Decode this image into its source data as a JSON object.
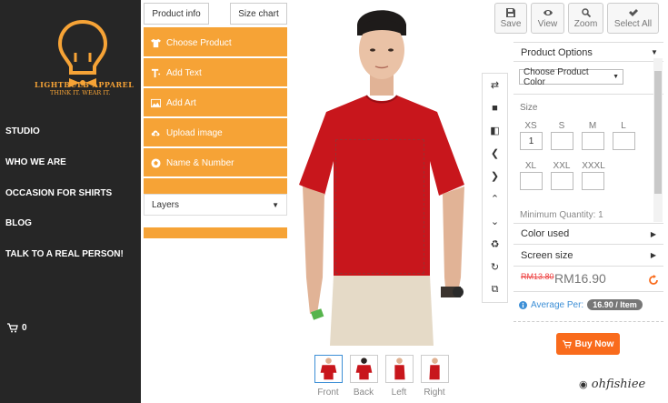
{
  "brand": {
    "name": "LIGHTBULB APPAREL",
    "tagline": "THINK IT. WEAR IT.",
    "color": "#f6a336"
  },
  "nav": {
    "items": [
      "STUDIO",
      "WHO WE ARE",
      "OCCASION FOR SHIRTS",
      "BLOG",
      "TALK TO A REAL PERSON!"
    ],
    "cart_count": "0"
  },
  "tabs": {
    "product_info": "Product info",
    "size_chart": "Size chart"
  },
  "menu": {
    "items": [
      {
        "label": "Choose Product",
        "icon": "tshirt-icon"
      },
      {
        "label": "Add Text",
        "icon": "text-icon"
      },
      {
        "label": "Add Art",
        "icon": "image-icon"
      },
      {
        "label": "Upload image",
        "icon": "cloud-upload-icon"
      },
      {
        "label": "Name & Number",
        "icon": "ball-icon"
      }
    ],
    "layers_label": "Layers"
  },
  "actions": {
    "save": "Save",
    "view": "View",
    "zoom": "Zoom",
    "select_all": "Select All"
  },
  "views": [
    "Front",
    "Back",
    "Left",
    "Right"
  ],
  "options": {
    "title": "Product Options",
    "color_select": "Choose Product Color",
    "size_label": "Size",
    "sizes_row1": [
      "XS",
      "S",
      "M",
      "L"
    ],
    "sizes_row2": [
      "XL",
      "XXL",
      "XXXL"
    ],
    "qty_xs": "1",
    "min_qty": "Minimum Quantity: 1",
    "color_used": "Color used",
    "screen_size": "Screen size"
  },
  "price": {
    "old": "RM13.80",
    "new": "RM16.90",
    "avg_label": "Average Per:",
    "avg_value": "16.90 / Item"
  },
  "buy_label": "Buy Now",
  "watermark": "ohfishiee",
  "colors": {
    "shirt": "#c8161c",
    "accent": "#f6a336",
    "buy": "#f96b1c",
    "nav_bg": "#262626"
  }
}
